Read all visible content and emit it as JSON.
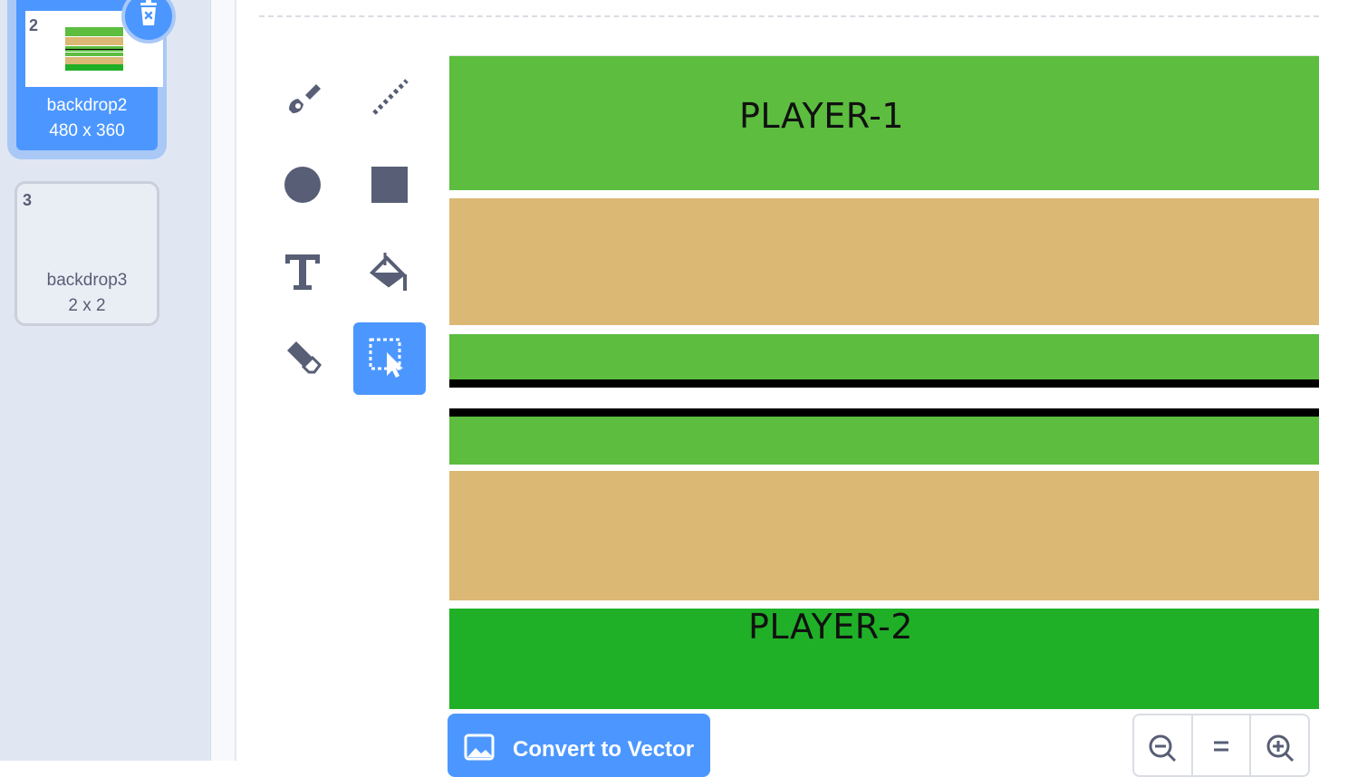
{
  "costumes": [
    {
      "number": "2",
      "name": "backdrop2",
      "size": "480 x 360",
      "selected": true
    },
    {
      "number": "3",
      "name": "backdrop3",
      "size": "2 x 2",
      "selected": false
    }
  ],
  "canvas": {
    "label_top": "PLAYER-1",
    "label_bottom": "PLAYER-2",
    "colors": {
      "green": "#5cbd3f",
      "dark_green": "#20b027",
      "sand": "#dbb874",
      "line": "#000000"
    }
  },
  "tools": [
    "brush-icon",
    "line-icon",
    "circle-icon",
    "rectangle-icon",
    "text-icon",
    "fill-icon",
    "eraser-icon",
    "select-icon"
  ],
  "footer": {
    "convert_label": "Convert to Vector",
    "zoom_out": "zoom-out-icon",
    "zoom_reset": "zoom-reset-icon",
    "zoom_in": "zoom-in-icon"
  },
  "theme": {
    "accent": "#4c97ff",
    "icon": "#575e75"
  }
}
